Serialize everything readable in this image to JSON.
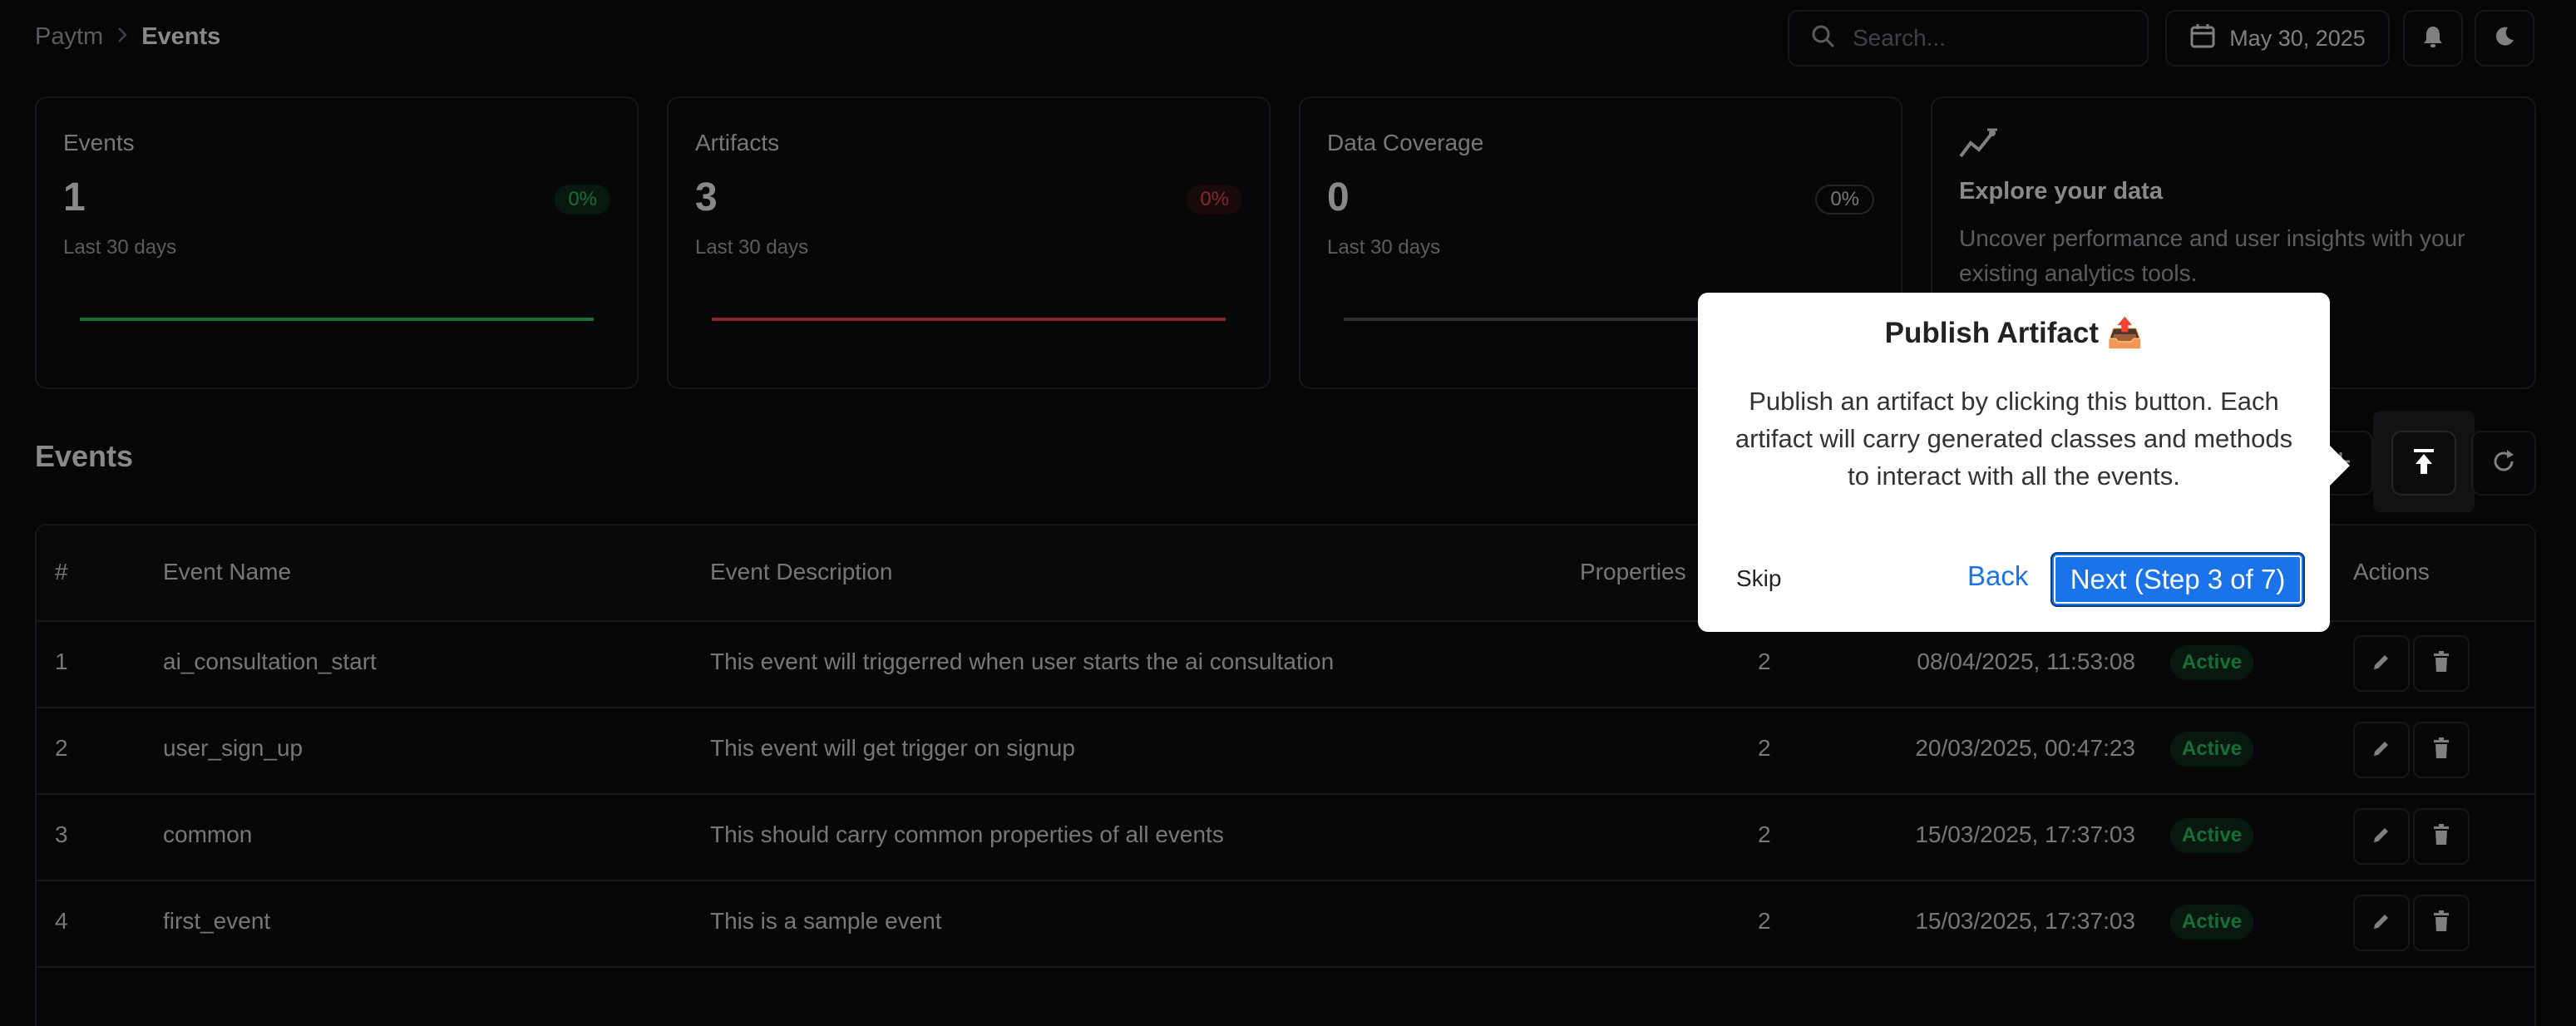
{
  "breadcrumb": {
    "root": "Paytm",
    "current": "Events"
  },
  "header": {
    "search_placeholder": "Search...",
    "date": "May 30, 2025"
  },
  "stats": [
    {
      "title": "Events",
      "value": "1",
      "pct": "0%",
      "sub": "Last 30 days",
      "color": "#22c55e"
    },
    {
      "title": "Artifacts",
      "value": "3",
      "pct": "0%",
      "sub": "Last 30 days",
      "color": "#ef4444"
    },
    {
      "title": "Data Coverage",
      "value": "0",
      "pct": "0%",
      "sub": "Last 30 days",
      "color": "#52525b"
    }
  ],
  "explore": {
    "title": "Explore your data",
    "desc": "Uncover performance and user insights with your existing analytics tools."
  },
  "section_title": "Events",
  "table": {
    "headers": [
      "#",
      "Event Name",
      "Event Description",
      "Properties",
      "Actions"
    ],
    "rows": [
      {
        "num": "1",
        "name": "ai_consultation_start",
        "desc": "This event will triggerred when user starts the ai consultation",
        "props": "2",
        "date": "08/04/2025, 11:53:08",
        "status": "Active"
      },
      {
        "num": "2",
        "name": "user_sign_up",
        "desc": "This event will get trigger on signup",
        "props": "2",
        "date": "20/03/2025, 00:47:23",
        "status": "Active"
      },
      {
        "num": "3",
        "name": "common",
        "desc": "This should carry common properties of all events",
        "props": "2",
        "date": "15/03/2025, 17:37:03",
        "status": "Active"
      },
      {
        "num": "4",
        "name": "first_event",
        "desc": "This is a sample event",
        "props": "2",
        "date": "15/03/2025, 17:37:03",
        "status": "Active"
      }
    ]
  },
  "popover": {
    "title": "Publish Artifact 📤",
    "body": "Publish an artifact by clicking this button. Each artifact will carry generated classes and methods to interact with all the events.",
    "skip": "Skip",
    "back": "Back",
    "next": "Next (Step 3 of 7)"
  }
}
